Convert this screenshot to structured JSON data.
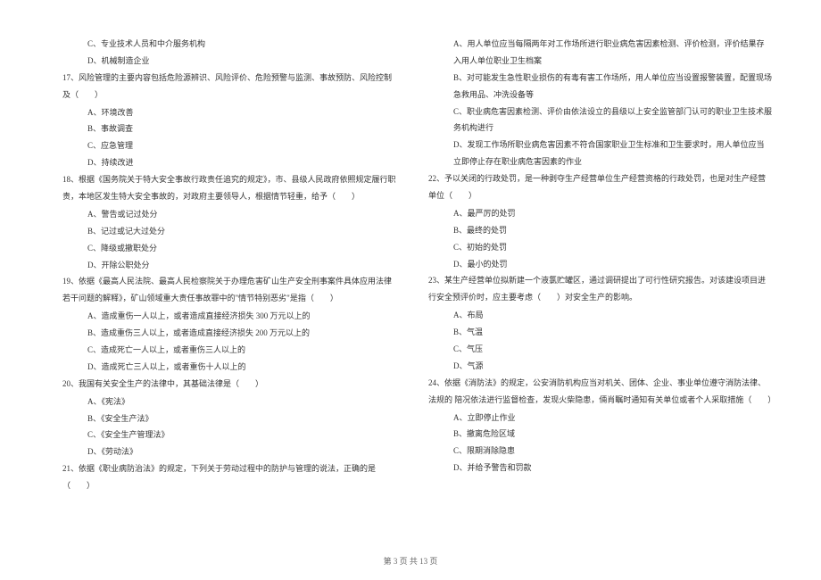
{
  "left_column": {
    "options_16": [
      "C、专业技术人员和中介服务机构",
      "D、机械制造企业"
    ],
    "q17": "17、风险管理的主要内容包括危险源辨识、风险评价、危险预警与监测、事故预防、风险控制及（　　）",
    "options_17": [
      "A、环境改善",
      "B、事故调查",
      "C、应急管理",
      "D、持续改进"
    ],
    "q18": "18、根据《国务院关于特大安全事故行政责任追究的规定》，市、县级人民政府依照规定履行职责，本地区发生特大安全事故的，对政府主要领导人，根据情节轻重，给予（　　）",
    "options_18": [
      "A、警告或记过处分",
      "B、记过或记大过处分",
      "C、降级或撤职处分",
      "D、开除公职处分"
    ],
    "q19": "19、依据《最高人民法院、最高人民检察院关于办理危害矿山生产安全刑事案件具体应用法律若干问题的解释》，矿山领域重大责任事故罪中的\"情节特别恶劣\"是指（　　）",
    "options_19": [
      "A、造成重伤一人以上，或者造成直接经济损失 300 万元以上的",
      "B、造成重伤三人以上，或者造成直接经济损失 200 万元以上的",
      "C、造成死亡一人以上，或者重伤三人以上的",
      "D、造成死亡三人以上，或者重伤十人以上的"
    ],
    "q20": "20、我国有关安全生产的法律中，其基础法律是（　　）",
    "options_20": [
      "A、《宪法》",
      "B、《安全生产法》",
      "C、《安全生产管理法》",
      "D、《劳动法》"
    ],
    "q21": "21、依据《职业病防治法》的规定，下列关于劳动过程中的防护与管理的说法，正确的是（　　）"
  },
  "right_column": {
    "options_21": [
      "A、用人单位应当每隔两年对工作场所进行职业病危害因素检测、评价检测，评价结果存入用人单位职业卫生档案",
      "B、对可能发生急性职业损伤的有毒有害工作场所，用人单位应当设置报警装置，配置现场急救用品、冲洗设备等",
      "C、职业病危害因素检测、评价由依法设立的县级以上安全监管部门认可的职业卫生技术服务机构进行",
      "D、发现工作场所职业病危害因素不符合国家职业卫生标准和卫生要求时，用人单位应当立即停止存在职业病危害因素的作业"
    ],
    "q22": "22、予以关闭的行政处罚，是一种剥夺生产经营单位生产经营资格的行政处罚，也是对生产经营单位（　　）",
    "options_22": [
      "A、最严厉的处罚",
      "B、最终的处罚",
      "C、初始的处罚",
      "D、最小的处罚"
    ],
    "q23": "23、某生产经营单位拟新建一个液氯贮罐区，通过调研提出了可行性研究报告。对该建设项目进行安全预评价时，应主要考虑（　　）对安全生产的影响。",
    "options_23": [
      "A、布局",
      "B、气温",
      "C、气压",
      "D、气源"
    ],
    "q24": "24、依据《消防法》的规定，公安消防机构应当对机关、团体、企业、事业单位遵守消防法律、法规的 陪况依法进行监督检查，发现火柴隐患，倆肖瞩时通知有关单位或者个人采取措施（　　）",
    "options_24": [
      "A、立即停止作业",
      "B、撤离危险区域",
      "C、限期消除隐患",
      "D、并给予警告和罚款"
    ]
  },
  "footer": "第 3 页 共 13 页"
}
